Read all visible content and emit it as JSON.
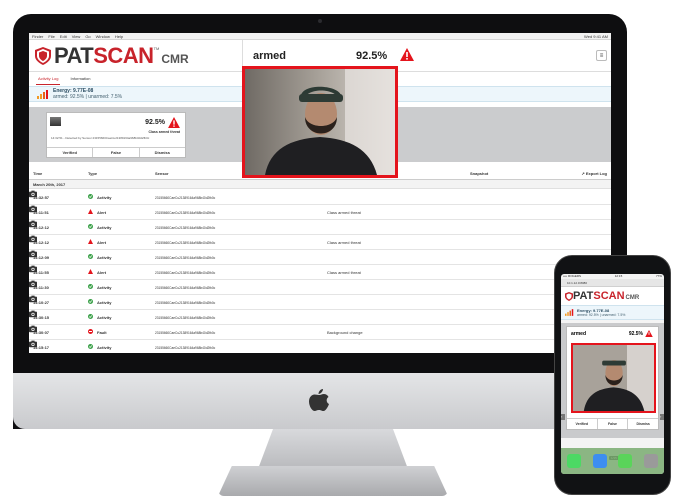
{
  "menubar": {
    "items": [
      "Finder",
      "File",
      "Edit",
      "View",
      "Go",
      "Window",
      "Help"
    ],
    "right": "Wed 9:41 AM"
  },
  "brand": {
    "pat": "PAT",
    "scan": "SCAN",
    "cmr": "CMR",
    "tm": "TM",
    "accent": "#c8232b"
  },
  "header": {
    "status": "armed",
    "percent": "92.5%",
    "menu_icon": "menu-icon"
  },
  "tabs": [
    {
      "label": "Activity Log",
      "active": true
    },
    {
      "label": "Information",
      "active": false
    }
  ],
  "energy": {
    "title": "Energy: 9.77E-08",
    "subtitle": "armed: 92.5% | unarmed: 7.5%"
  },
  "alert_card": {
    "percent": "92.5%",
    "classification": "Class armed threat",
    "detail": "14:32:51 - Detected by Sensor 23155660CaeCu21389164a968b40d2fb0c",
    "actions": [
      "Verified",
      "False",
      "Dismiss"
    ]
  },
  "table": {
    "columns": {
      "time": "Time",
      "type": "Type",
      "sensor": "Sensor",
      "snapshot": "Snapshot",
      "export": "Export Log"
    },
    "date_group": "March 20th, 2017",
    "rows": [
      {
        "time": "14:32:57",
        "type": "Activity",
        "kind": "activity",
        "sensor": "23155660CaeCu21389164a968b40d2fb0c",
        "desc": ""
      },
      {
        "time": "14:11:51",
        "type": "Alert",
        "kind": "alert",
        "sensor": "23155660CaeCu21389164a968b40d2fb0c",
        "desc": "Class armed threat"
      },
      {
        "time": "14:12:12",
        "type": "Activity",
        "kind": "activity",
        "sensor": "23155660CaeCu21389164a968b40d2fb0c",
        "desc": ""
      },
      {
        "time": "14:12:12",
        "type": "Alert",
        "kind": "alert",
        "sensor": "23155660CaeCu21389164a968b40d2fb0c",
        "desc": "Class armed threat"
      },
      {
        "time": "14:12:09",
        "type": "Activity",
        "kind": "activity",
        "sensor": "23155660CaeCu21389164a968b40d2fb0c",
        "desc": ""
      },
      {
        "time": "14:11:55",
        "type": "Alert",
        "kind": "alert",
        "sensor": "23155660CaeCu21389164a968b40d2fb0c",
        "desc": "Class armed threat"
      },
      {
        "time": "14:11:30",
        "type": "Activity",
        "kind": "activity",
        "sensor": "23155660CaeCu21389164a968b40d2fb0c",
        "desc": ""
      },
      {
        "time": "14:10:27",
        "type": "Activity",
        "kind": "activity",
        "sensor": "23155660CaeCu21389164a968b40d2fb0c",
        "desc": ""
      },
      {
        "time": "14:30:15",
        "type": "Activity",
        "kind": "activity",
        "sensor": "23155660CaeCu21389164a968b40d2fb0c",
        "desc": ""
      },
      {
        "time": "14:30:07",
        "type": "Fault",
        "kind": "fault",
        "sensor": "23155660CaeCu21389164a968b40d2fb0c",
        "desc": "Background change"
      },
      {
        "time": "14:15:17",
        "type": "Activity",
        "kind": "activity",
        "sensor": "23155660CaeCu21389164a968b40d2fb0c",
        "desc": ""
      }
    ]
  },
  "phone": {
    "time": "12:15",
    "carrier": "•••• ROGERS",
    "battery": "77%",
    "url": "10.1.12.0:8080",
    "energy_title": "Energy: 9.77E-08",
    "energy_sub": "armed: 92.5% | unarmed: 7.5%",
    "status": "armed",
    "percent": "92.5%",
    "actions": [
      "Verified",
      "False",
      "Dismiss"
    ],
    "page": "1/15",
    "dock": [
      "Phone",
      "Safari",
      "Messages",
      "Contacts"
    ]
  },
  "colors": {
    "alert": "#e4141c",
    "activity": "#3aa048",
    "fault": "#e4141c"
  }
}
